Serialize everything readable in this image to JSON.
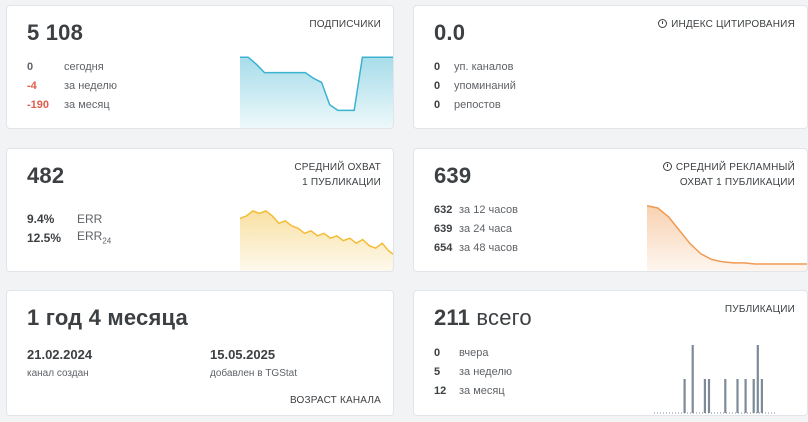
{
  "subscribers": {
    "value": "5 108",
    "label": "ПОДПИСЧИКИ",
    "rows": [
      {
        "value": "0",
        "text": "сегодня",
        "negative": false
      },
      {
        "value": "-4",
        "text": "за неделю",
        "negative": true
      },
      {
        "value": "-190",
        "text": "за месяц",
        "negative": true
      }
    ],
    "chart_data": {
      "type": "area",
      "values": [
        52,
        52,
        47,
        41,
        41,
        41,
        41,
        41,
        41,
        37,
        34,
        18,
        14,
        14,
        14,
        52,
        52,
        52,
        52,
        52
      ],
      "color": "#3bb3d0"
    }
  },
  "citation": {
    "value": "0.0",
    "label": "ИНДЕКС ЦИТИРОВАНИЯ",
    "rows": [
      {
        "value": "0",
        "text": "уп. каналов"
      },
      {
        "value": "0",
        "text": "упоминаний"
      },
      {
        "value": "0",
        "text": "репостов"
      }
    ],
    "chart_data": {
      "type": "line",
      "values": [
        0,
        0
      ],
      "color": "#2eaa4b"
    }
  },
  "reach": {
    "value": "482",
    "label_line1": "СРЕДНИЙ ОХВАТ",
    "label_line2": "1 ПУБЛИКАЦИИ",
    "err_value": "9.4%",
    "err_label": "ERR",
    "err24_value": "12.5%",
    "err24_label": "ERR",
    "err24_sub": "24",
    "chart_data": {
      "type": "area",
      "values": [
        44,
        46,
        50,
        48,
        50,
        46,
        40,
        42,
        38,
        36,
        32,
        34,
        30,
        32,
        28,
        30,
        26,
        28,
        24,
        27,
        22,
        20,
        24,
        18,
        14
      ],
      "color": "#f2bc35"
    }
  },
  "ad_reach": {
    "value": "639",
    "label_line1": "СРЕДНИЙ РЕКЛАМНЫЙ",
    "label_line2": "ОХВАТ 1 ПУБЛИКАЦИИ",
    "rows": [
      {
        "value": "632",
        "text": "за 12 часов"
      },
      {
        "value": "639",
        "text": "за 24 часа"
      },
      {
        "value": "654",
        "text": "за 48 часов"
      }
    ],
    "chart_data": {
      "type": "area",
      "values": [
        60,
        58,
        50,
        38,
        26,
        17,
        12,
        10,
        9,
        9,
        8,
        8,
        8,
        8,
        8,
        8
      ],
      "color": "#f09a52"
    }
  },
  "age": {
    "value": "1 год 4 месяца",
    "created_date": "21.02.2024",
    "created_label": "канал создан",
    "added_date": "15.05.2025",
    "added_label": "добавлен в TGStat",
    "label": "ВОЗРАСТ КАНАЛА"
  },
  "publications": {
    "value": "211",
    "unit": "всего",
    "label": "ПУБЛИКАЦИИ",
    "rows": [
      {
        "value": "0",
        "text": "вчера"
      },
      {
        "value": "5",
        "text": "за неделю"
      },
      {
        "value": "12",
        "text": "за месяц"
      }
    ],
    "chart_data": {
      "type": "bar",
      "values": [
        0,
        0,
        0,
        0,
        0,
        0,
        0,
        1,
        0,
        2,
        0,
        0,
        1,
        1,
        0,
        0,
        0,
        1,
        0,
        0,
        1,
        0,
        1,
        0,
        1,
        2,
        1,
        0,
        0,
        0
      ],
      "color": "#7d8a98"
    }
  }
}
